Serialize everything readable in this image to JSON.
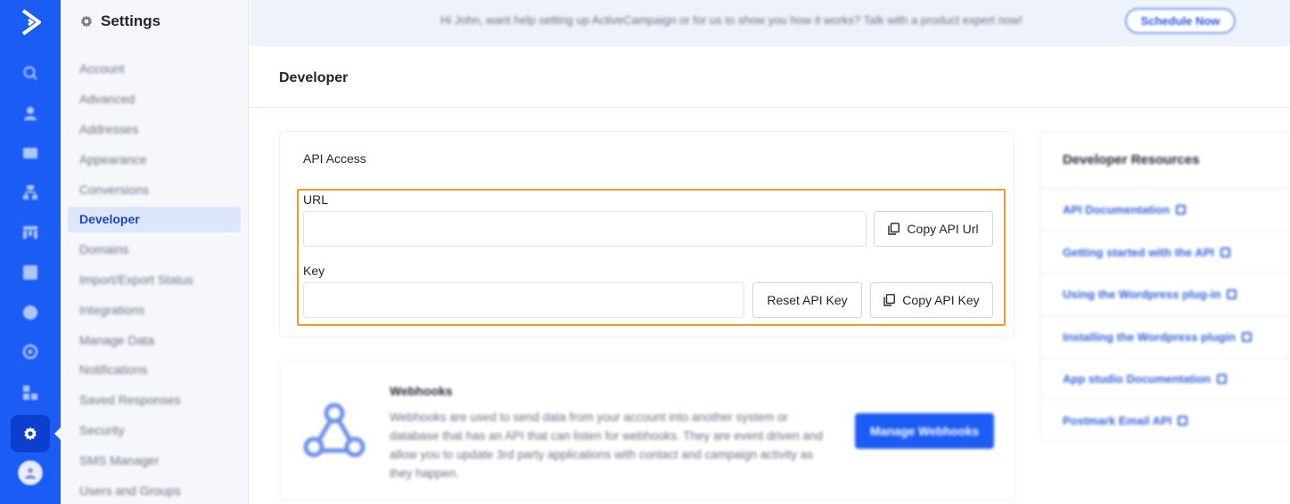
{
  "rail": {
    "logo_icon": "activecampaign-logo-icon",
    "icons": [
      "search-icon",
      "contacts-icon",
      "campaigns-icon",
      "automations-icon",
      "deals-icon",
      "lists-icon",
      "reports-icon",
      "apps-icon",
      "conversations-icon",
      "settings-icon"
    ],
    "active": "settings-icon",
    "accent": "#1b5cf5"
  },
  "sidebar": {
    "title": "Settings",
    "items": [
      {
        "label": "Account"
      },
      {
        "label": "Advanced"
      },
      {
        "label": "Addresses"
      },
      {
        "label": "Appearance"
      },
      {
        "label": "Conversions"
      },
      {
        "label": "Developer"
      },
      {
        "label": "Domains"
      },
      {
        "label": "Import/Export Status"
      },
      {
        "label": "Integrations"
      },
      {
        "label": "Manage Data"
      },
      {
        "label": "Notifications"
      },
      {
        "label": "Saved Responses"
      },
      {
        "label": "Security"
      },
      {
        "label": "SMS Manager"
      },
      {
        "label": "Users and Groups"
      }
    ],
    "active_item": "Developer"
  },
  "banner": {
    "message": "Hi John, want help setting up ActiveCampaign or for us to show you how it works? Talk with a product expert now!",
    "schedule_label": "Schedule Now"
  },
  "page": {
    "title": "Developer"
  },
  "api_access": {
    "title": "API Access",
    "url_label": "URL",
    "url_value": "",
    "copy_url_label": "Copy API Url",
    "key_label": "Key",
    "key_value": "",
    "reset_key_label": "Reset API Key",
    "copy_key_label": "Copy API Key",
    "highlight_color": "#f0992a"
  },
  "webhooks": {
    "title": "Webhooks",
    "description": "Webhooks are used to send data from your account into another system or database that has an API that can listen for webhooks. They are event driven and allow you to update 3rd party applications with contact and campaign activity as they happen.",
    "button_label": "Manage Webhooks"
  },
  "resources": {
    "title": "Developer Resources",
    "links": [
      {
        "label": "API Documentation"
      },
      {
        "label": "Getting started with the API"
      },
      {
        "label": "Using the Wordpress plug-in"
      },
      {
        "label": "Installing the Wordpress plugin"
      },
      {
        "label": "App studio Documentation"
      },
      {
        "label": "Postmark Email API"
      }
    ]
  }
}
